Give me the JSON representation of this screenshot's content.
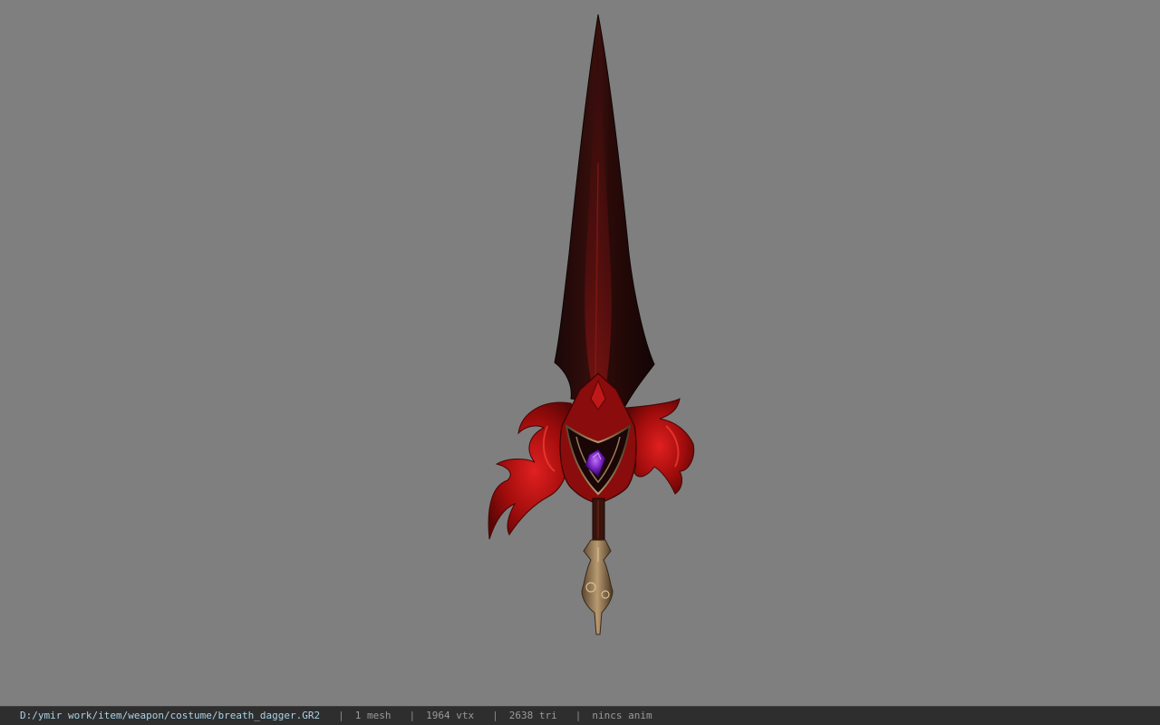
{
  "viewport": {
    "background_color": "#7f7f7f",
    "model_name": "breath_dagger"
  },
  "statusbar": {
    "file_path": "D:/ymir work/item/weapon/costume/breath_dagger.GR2",
    "separator": "|",
    "mesh_count": "1 mesh",
    "vertex_count": "1964 vtx",
    "triangle_count": "2638 tri",
    "anim_status": "nincs anim",
    "path_color": "#a9d3e6",
    "text_color": "#9a9a9a"
  }
}
